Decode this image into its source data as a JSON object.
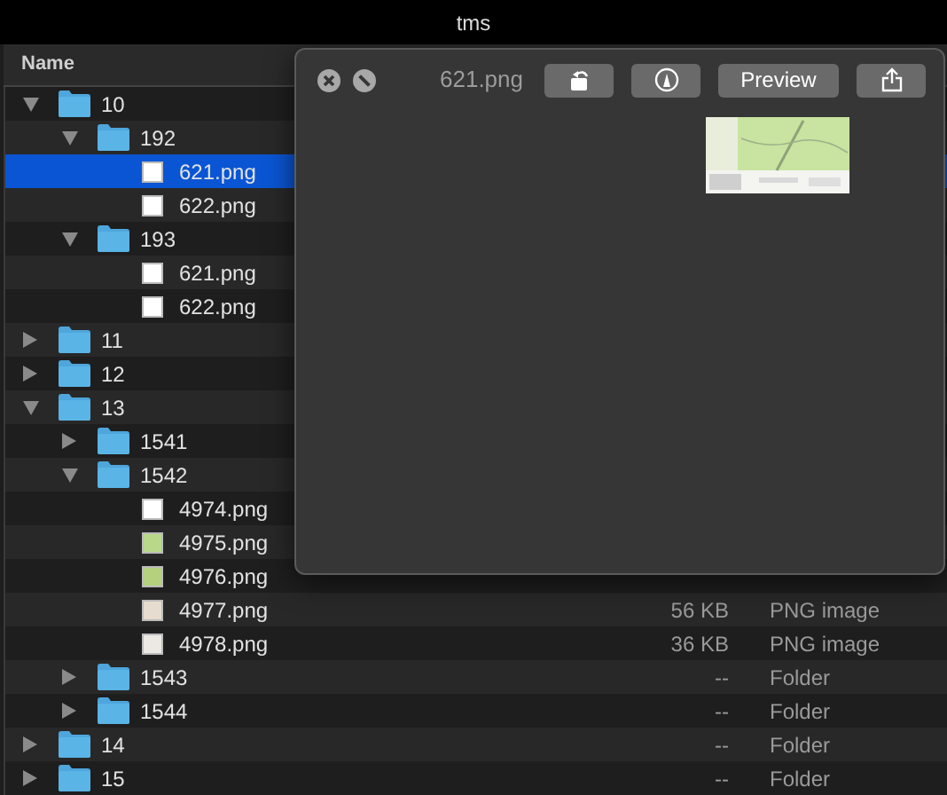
{
  "window": {
    "title": "tms"
  },
  "columns": [
    {
      "label": "Name"
    }
  ],
  "tree": [
    {
      "kind": "folder",
      "name": "10",
      "expanded": true,
      "selected": false,
      "children": [
        {
          "kind": "folder",
          "name": "192",
          "expanded": true,
          "selected": false,
          "children": [
            {
              "kind": "file",
              "name": "621.png",
              "selected": true,
              "color": "#ffffff"
            },
            {
              "kind": "file",
              "name": "622.png",
              "selected": false,
              "color": "#ffffff"
            }
          ]
        },
        {
          "kind": "folder",
          "name": "193",
          "expanded": true,
          "selected": false,
          "children": [
            {
              "kind": "file",
              "name": "621.png",
              "selected": false,
              "color": "#ffffff"
            },
            {
              "kind": "file",
              "name": "622.png",
              "selected": false,
              "color": "#ffffff"
            }
          ]
        }
      ]
    },
    {
      "kind": "folder",
      "name": "11",
      "expanded": false,
      "selected": false
    },
    {
      "kind": "folder",
      "name": "12",
      "expanded": false,
      "selected": false
    },
    {
      "kind": "folder",
      "name": "13",
      "expanded": true,
      "selected": false,
      "children": [
        {
          "kind": "folder",
          "name": "1541",
          "expanded": false,
          "selected": false
        },
        {
          "kind": "folder",
          "name": "1542",
          "expanded": true,
          "selected": false,
          "children": [
            {
              "kind": "file",
              "name": "4974.png",
              "selected": false,
              "color": "#ffffff"
            },
            {
              "kind": "file",
              "name": "4975.png",
              "selected": false,
              "color": "#b9d889"
            },
            {
              "kind": "file",
              "name": "4976.png",
              "selected": false,
              "color": "#b3d17f"
            },
            {
              "kind": "file",
              "name": "4977.png",
              "selected": false,
              "color": "#e6dccf",
              "size": "56 KB",
              "type": "PNG image"
            },
            {
              "kind": "file",
              "name": "4978.png",
              "selected": false,
              "color": "#ece8e4",
              "size": "36 KB",
              "type": "PNG image"
            }
          ]
        },
        {
          "kind": "folder",
          "name": "1543",
          "expanded": false,
          "selected": false,
          "size": "--",
          "type": "Folder"
        },
        {
          "kind": "folder",
          "name": "1544",
          "expanded": false,
          "selected": false,
          "size": "--",
          "type": "Folder"
        }
      ]
    },
    {
      "kind": "folder",
      "name": "14",
      "expanded": false,
      "selected": false,
      "size": "--",
      "type": "Folder"
    },
    {
      "kind": "folder",
      "name": "15",
      "expanded": false,
      "selected": false,
      "size": "--",
      "type": "Folder"
    }
  ],
  "quicklook": {
    "filename": "621.png",
    "open_button": "Preview"
  }
}
